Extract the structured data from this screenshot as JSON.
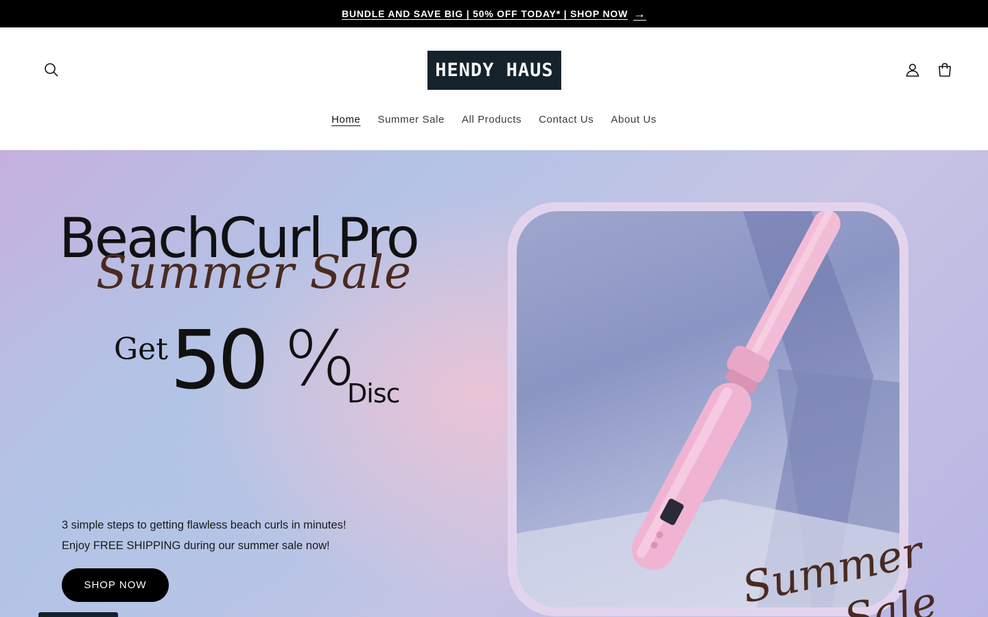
{
  "announcement": {
    "text": "BUNDLE AND SAVE BIG | 50% OFF TODAY* | SHOP NOW",
    "arrow": "→"
  },
  "header": {
    "logo_text": "HENDY HAUS",
    "icons": {
      "search": "search-icon",
      "account": "account-icon",
      "cart": "cart-icon"
    },
    "nav": [
      {
        "label": "Home",
        "active": true
      },
      {
        "label": "Summer Sale",
        "active": false
      },
      {
        "label": "All Products",
        "active": false
      },
      {
        "label": "Contact Us",
        "active": false
      },
      {
        "label": "About Us",
        "active": false
      }
    ]
  },
  "hero": {
    "title": "BeachCurl Pro",
    "script": "Summer Sale",
    "offer": {
      "get": "Get",
      "number": "50",
      "percent": "%",
      "disc": "Disc"
    },
    "copy_line_1": "3 simple steps to getting flawless beach curls in minutes!",
    "copy_line_2": "Enjoy FREE SHIPPING during our summer sale now!",
    "cta_label": "SHOP NOW",
    "product_script_1": "Summer",
    "product_script_2": "Sale"
  },
  "colors": {
    "announcement_bg": "#000000",
    "logo_bg": "#15222b",
    "cta_bg": "#000000",
    "script_brown": "#4a2a20",
    "product_pink": "#f0b8d4"
  }
}
